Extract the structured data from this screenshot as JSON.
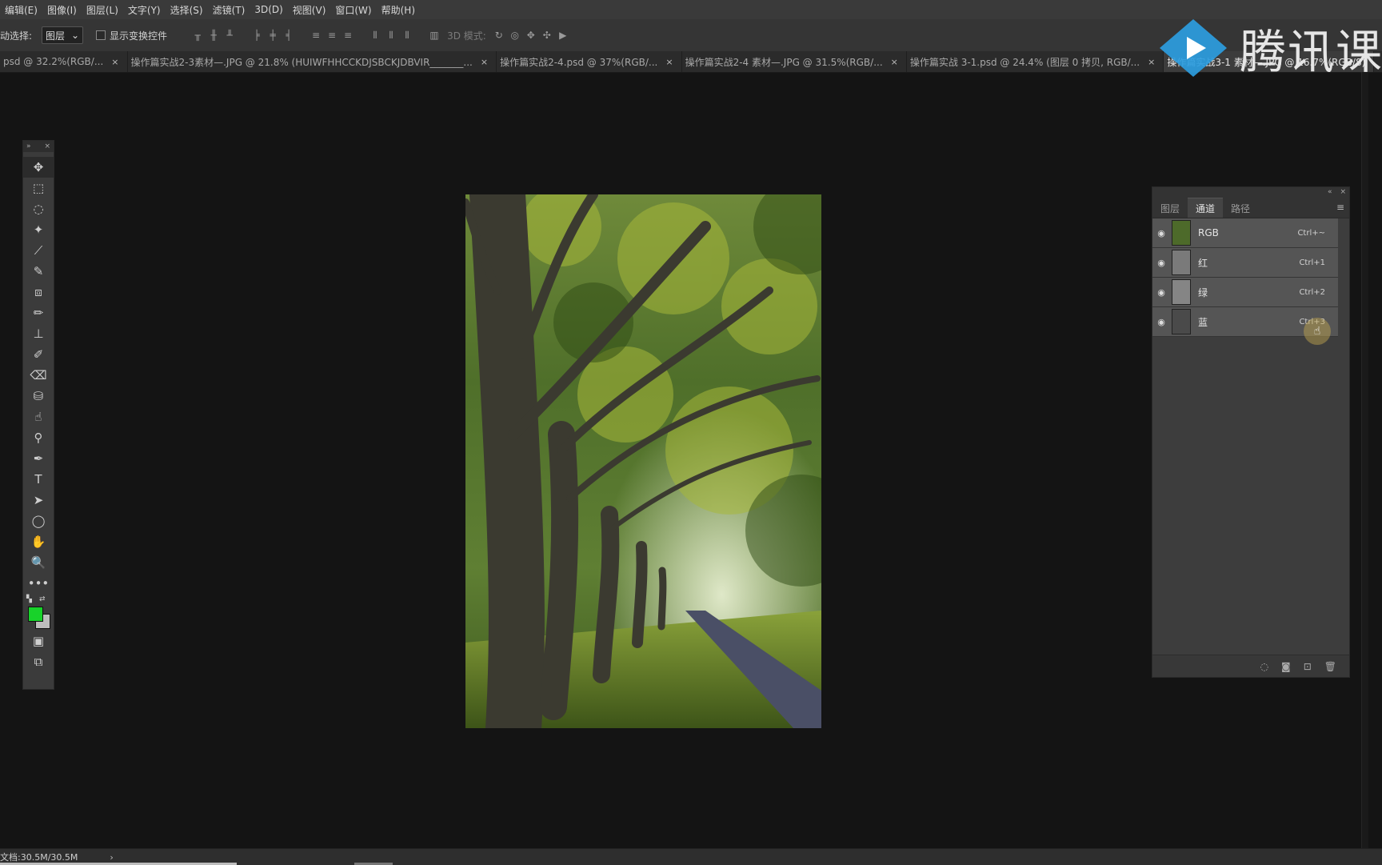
{
  "menu": [
    "编辑(E)",
    "图像(I)",
    "图层(L)",
    "文字(Y)",
    "选择(S)",
    "滤镜(T)",
    "3D(D)",
    "视图(V)",
    "窗口(W)",
    "帮助(H)"
  ],
  "options": {
    "auto_select_label": "动选择:",
    "auto_select_value": "图层",
    "show_transform_label": "显示变换控件",
    "mode_3d_label": "3D 模式:"
  },
  "tabs": [
    {
      "label": "psd @ 32.2%(RGB/...",
      "active": false
    },
    {
      "label": "操作篇实战2-3素材—.JPG @ 21.8% (HUIWFHHCCKDJSBCKJDBVIR_______...",
      "active": false
    },
    {
      "label": "操作篇实战2-4.psd @ 37%(RGB/...",
      "active": false
    },
    {
      "label": "操作篇实战2-4 素材—.JPG @ 31.5%(RGB/...",
      "active": false
    },
    {
      "label": "操作篇实战 3-1.psd @ 24.4% (图层 0 拷贝, RGB/...",
      "active": false
    },
    {
      "label": "操作篇实战3-1 素材—.JPG @ 16.7%(RGB/8)",
      "active": true
    }
  ],
  "logo": {
    "text": "腾讯课堂",
    "color": "#2d9de0"
  },
  "tools": [
    "move-icon",
    "marquee-icon",
    "lasso-icon",
    "magic-wand-icon",
    "crop-icon",
    "eyedropper-icon",
    "frame-icon",
    "brush-icon",
    "stamp-icon",
    "history-brush-icon",
    "eraser-icon",
    "paint-bucket-icon",
    "smudge-icon",
    "dodge-icon",
    "pen-icon",
    "type-icon",
    "path-select-icon",
    "ellipse-icon",
    "hand-icon",
    "zoom-icon",
    "more-icon"
  ],
  "tool_glyphs": [
    "✥",
    "⬚",
    "◌",
    "✦",
    "⟋",
    "✎",
    "⧈",
    "✏",
    "⊥",
    "✐",
    "⌫",
    "⛁",
    "☝",
    "⚲",
    "✒",
    "T",
    "➤",
    "◯",
    "✋",
    "🔍",
    "•••"
  ],
  "colors": {
    "foreground": "#18d22a",
    "background": "#bdbdbd"
  },
  "panel": {
    "tabs": [
      "图层",
      "通道",
      "路径"
    ],
    "active_tab": "通道",
    "channels": [
      {
        "name": "RGB",
        "shortcut": "Ctrl+~"
      },
      {
        "name": "红",
        "shortcut": "Ctrl+1"
      },
      {
        "name": "绿",
        "shortcut": "Ctrl+2"
      },
      {
        "name": "蓝",
        "shortcut": "Ctrl+3"
      }
    ]
  },
  "status": {
    "doc": "文档:30.5M/30.5M",
    "arrow": "›"
  }
}
